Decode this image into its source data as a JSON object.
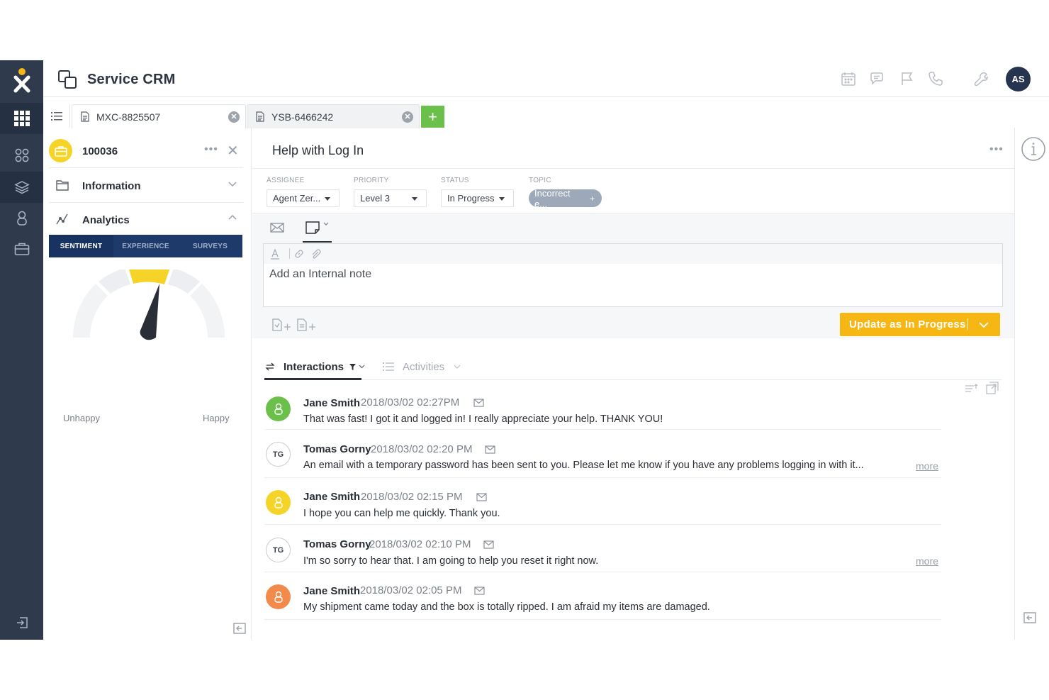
{
  "app": {
    "title": "Service CRM",
    "user_initials": "AS",
    "brand_color": "#f6b715",
    "nav_color": "#2f3a4c"
  },
  "leftnav": {
    "items": [
      "apps-grid-icon",
      "dashboard-icon",
      "layers-icon",
      "contacts-icon",
      "briefcase-icon",
      "logout-icon"
    ]
  },
  "header_icons": [
    "calendar-icon",
    "chat-icon",
    "flag-icon",
    "phone-icon",
    "wrench-icon"
  ],
  "tabs": [
    {
      "label": "MXC-8825507",
      "active": true
    },
    {
      "label": "YSB-6466242",
      "active": false
    }
  ],
  "add_tab_label": "+",
  "case_panel": {
    "case_id": "100036",
    "more": "•••",
    "close": "✕",
    "sections": [
      {
        "label": "Information",
        "expanded": false
      },
      {
        "label": "Analytics",
        "expanded": true
      }
    ],
    "segments": [
      "SENTIMENT",
      "EXPERIENCE",
      "SURVEYS"
    ],
    "active_segment": "SENTIMENT",
    "gauge": {
      "low_label": "Unhappy",
      "high_label": "Happy",
      "value": 0.5
    }
  },
  "case": {
    "title": "Help with Log In",
    "more": "•••",
    "fields": {
      "assignee": {
        "label": "ASSIGNEE",
        "value": "Agent Zer..."
      },
      "priority": {
        "label": "PRIORITY",
        "value": "Level 3"
      },
      "status": {
        "label": "STATUS",
        "value": "In Progress"
      },
      "topic": {
        "label": "TOPIC",
        "value": "Incorrect e...",
        "add": "+"
      }
    }
  },
  "composer": {
    "placeholder": "Add an Internal note",
    "update_button": "Update as In Progress"
  },
  "feed_tabs": [
    {
      "label": "Interactions",
      "active": true
    },
    {
      "label": "Activities",
      "active": false
    }
  ],
  "feed": [
    {
      "name": "Jane Smith",
      "time": "2018/03/02 02:27PM",
      "text": "That was fast! I got it and logged in! I really appreciate your help. THANK YOU!",
      "avatar": "user-icon",
      "avatar_color": "#6bc04b",
      "more": ""
    },
    {
      "name": "Tomas Gorny",
      "time": "2018/03/02 02:20 PM",
      "text": "An email with a temporary password has been sent to you. Please let me know if you have any problems logging in with it...",
      "avatar": "TG",
      "avatar_color": "#ffffff",
      "more": "more"
    },
    {
      "name": "Jane Smith",
      "time": "2018/03/02 02:15 PM",
      "text": "I hope you can help me quickly. Thank you.",
      "avatar": "user-icon",
      "avatar_color": "#f5d327",
      "more": ""
    },
    {
      "name": "Tomas Gorny",
      "time": "2018/03/02 02:10 PM",
      "text": "I'm so sorry to hear that. I am going to help you reset it right now.",
      "avatar": "TG",
      "avatar_color": "#ffffff",
      "more": "more"
    },
    {
      "name": "Jane Smith",
      "time": "2018/03/02 02:05 PM",
      "text": "My shipment came today and the box is totally ripped. I am afraid my items are damaged.",
      "avatar": "user-icon",
      "avatar_color": "#f28a4b",
      "more": ""
    }
  ]
}
